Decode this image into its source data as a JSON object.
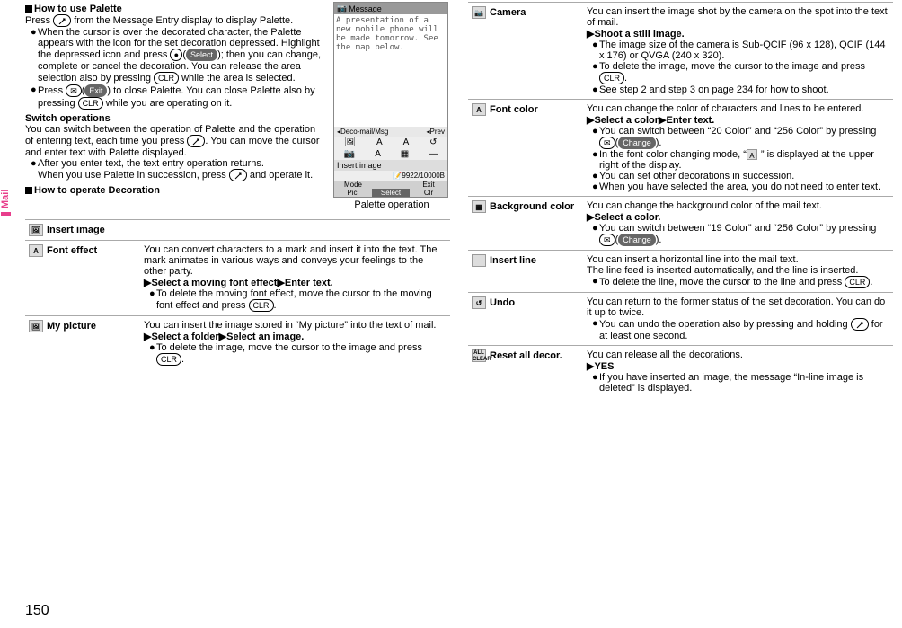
{
  "page_number": "150",
  "side_tab": "Mail",
  "left": {
    "h_palette": "How to use Palette",
    "p1_a": "Press ",
    "p1_b": " from the Message Entry display to display Palette.",
    "b1_a": "When the cursor is over the decorated character, the Palette appears with the icon for the set decoration depressed. Highlight the depressed icon and press ",
    "b1_aa": "(",
    "b1_ab": "); then you can change, complete or cancel the decoration. You can release the area selection also by pressing ",
    "b1_b": " while the area is selected.",
    "b2_a": "Press ",
    "b2_aa": "(",
    "b2_ab": ") to close Palette. You can close Palette also by pressing ",
    "b2_b": " while you are operating on it.",
    "h_switch": "Switch operations",
    "sw1": "You can switch between the operation of Palette and the operation of entering text, each time you press ",
    "sw1b": ". You can move the cursor and enter text with Palette displayed.",
    "b3_a": "After you enter text, the text entry operation returns.",
    "b3_b": "When you use Palette in succession, press ",
    "b3_c": " and operate it.",
    "h_operate": "How to operate Decoration",
    "fig_caption": "Palette operation",
    "phone": {
      "title": "Message",
      "body": "A presentation of a new mobile phone will be made tomorrow. See the map below.",
      "toolbar_left": "Deco-mail/Msg",
      "toolbar_right": "Prev",
      "insert": "Insert image",
      "count": "9922/10000",
      "sk_mode": "Mode",
      "sk_exit": "Exit",
      "sk_pic": "Pic.",
      "sk_select": "Select",
      "sk_clr": "Clr"
    },
    "btn_select": "Select",
    "btn_exit": "Exit",
    "btn_clr": "CLR",
    "table": {
      "insert_image": {
        "label": "Insert image"
      },
      "font_effect": {
        "label": "Font effect",
        "d1": "You can convert characters to a mark and insert it into the text. The mark animates in various ways and conveys your feelings to the other party.",
        "d2": "Select a moving font effect",
        "d2b": "Enter text.",
        "d3": "To delete the moving font effect, move the cursor to the moving font effect and press ",
        "d3b": "."
      },
      "my_picture": {
        "label": "My picture",
        "d1": "You can insert the image stored in “My picture” into the text of mail.",
        "d2": "Select a folder",
        "d2b": "Select an image.",
        "d3": "To delete the image, move the cursor to the image and press ",
        "d3b": "."
      }
    }
  },
  "right": {
    "btn_change": "Change",
    "camera": {
      "label": "Camera",
      "d1": "You can insert the image shot by the camera on the spot into the text of mail.",
      "d2": "Shoot a still image.",
      "d3": "The image size of the camera is Sub-QCIF (96 x 128), QCIF (144 x 176) or QVGA (240 x 320).",
      "d4a": "To delete the image, move the cursor to the image and press ",
      "d4b": ".",
      "d5": "See step 2 and step 3 on page 234 for how to shoot."
    },
    "font_color": {
      "label": "Font color",
      "d1": "You can change the color of characters and lines to be entered.",
      "d2": "Select a color",
      "d2b": "Enter text.",
      "d3a": "You can switch between “20 Color” and “256 Color” by pressing ",
      "d3b": "(",
      "d3c": ").",
      "d4a": "In the font color changing mode, “",
      "d4b": "” is displayed at the upper right of the display.",
      "d5": "You can set other decorations in succession.",
      "d6": "When you have selected the area, you do not need to enter text."
    },
    "bg_color": {
      "label": "Background color",
      "d1": "You can change the background color of the mail text.",
      "d2": "Select a color.",
      "d3a": "You can switch between “19 Color” and “256 Color” by pressing ",
      "d3b": "(",
      "d3c": ")."
    },
    "insert_line": {
      "label": "Insert line",
      "d1": "You can insert a horizontal line into the mail text.",
      "d2": "The line feed is inserted automatically, and the line is inserted.",
      "d3a": "To delete the line, move the cursor to the line and press ",
      "d3b": "."
    },
    "undo": {
      "label": "Undo",
      "d1": "You can return to the former status of the set decoration. You can do it up to twice.",
      "d2a": "You can undo the operation also by pressing and holding ",
      "d2b": " for at least one second."
    },
    "reset": {
      "label": "Reset all decor.",
      "d1": "You can release all the decorations.",
      "d2": "YES",
      "d3": "If you have inserted an image, the message “In-line image is deleted” is displayed."
    }
  }
}
